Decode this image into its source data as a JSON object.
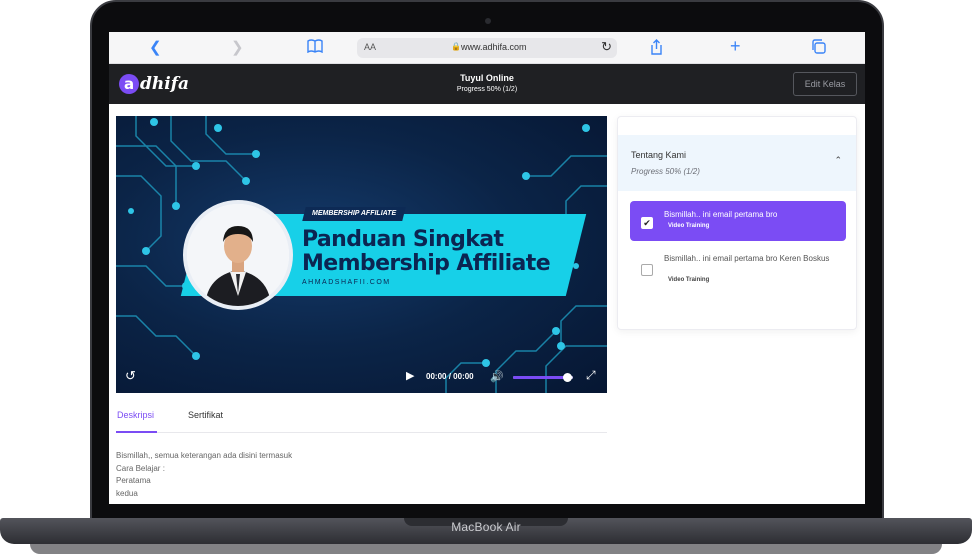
{
  "device": {
    "label": "MacBook Air"
  },
  "browser": {
    "aa_label": "AA",
    "url": "www.adhifa.com"
  },
  "header": {
    "logo_letter": "a",
    "logo_text": "dhifa",
    "course_title": "Tuyul Online",
    "course_progress": "Progress 50% (1/2)",
    "edit_button": "Edit Kelas"
  },
  "video": {
    "badge": "MEMBERSHIP AFFILIATE",
    "title_line1": "Panduan Singkat",
    "title_line2": "Membership Affiliate",
    "site": "AHMADSHAFII.COM",
    "time_current": "00:00",
    "time_separator": "/",
    "time_total": "00:00",
    "volume_level": 0.9
  },
  "tabs": [
    {
      "label": "Deskripsi",
      "active": true
    },
    {
      "label": "Sertifikat",
      "active": false
    }
  ],
  "description": {
    "lines": [
      "Bismillah,, semua keterangan ada disini termasuk",
      "Cara Belajar :",
      "Peratama",
      "kedua"
    ]
  },
  "sidebar": {
    "section_title": "Tentang Kami",
    "section_progress": "Progress 50% (1/2)",
    "lessons": [
      {
        "title": "Bismillah.. ini email pertama bro",
        "type": "Video Training",
        "checked": true
      },
      {
        "title": "Bismillah.. ini email pertama bro Keren Boskus",
        "type": "Video Training",
        "checked": false
      }
    ]
  },
  "colors": {
    "accent": "#7b4cf4",
    "header_bg": "#1f2023",
    "banner": "#17d0e8",
    "video_bg": "#0b2447"
  }
}
